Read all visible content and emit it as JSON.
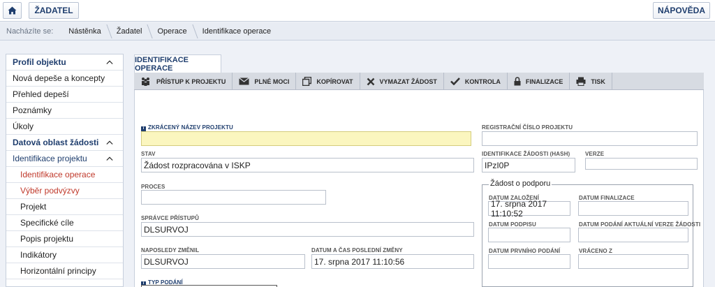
{
  "topbar": {
    "zadatel_label": "ŽADATEL",
    "napoveda_label": "NÁPOVĚDA"
  },
  "breadcrumb": {
    "prefix": "Nacházíte se:",
    "items": [
      "Nástěnka",
      "Žadatel",
      "Operace",
      "Identifikace operace"
    ]
  },
  "sidebar": {
    "items": [
      {
        "label": "Profil objektu"
      },
      {
        "label": "Nová depeše a koncepty"
      },
      {
        "label": "Přehled depeší"
      },
      {
        "label": "Poznámky"
      },
      {
        "label": "Úkoly"
      },
      {
        "label": "Datová oblast žádosti"
      },
      {
        "label": "Identifikace projektu"
      },
      {
        "label": "Identifikace operace"
      },
      {
        "label": "Výběr podvýzvy"
      },
      {
        "label": "Projekt"
      },
      {
        "label": "Specifické cíle"
      },
      {
        "label": "Popis projektu"
      },
      {
        "label": "Indikátory"
      },
      {
        "label": "Horizontální principy"
      }
    ]
  },
  "main": {
    "tab_label": "IDENTIFIKACE OPERACE",
    "toolbar": {
      "pristup": "PŘÍSTUP K PROJEKTU",
      "plne_moci": "PLNÉ MOCI",
      "kopirovat": "KOPÍROVAT",
      "vymazat": "VYMAZAT ŽÁDOST",
      "kontrola": "KONTROLA",
      "finalizace": "FINALIZACE",
      "tisk": "TISK"
    },
    "form": {
      "zkraceny_label": "ZKRÁCENÝ NÁZEV PROJEKTU",
      "zkraceny_value": "",
      "registracni_label": "REGISTRAČNÍ ČÍSLO PROJEKTU",
      "registracni_value": "",
      "stav_label": "STAV",
      "stav_value": "Žádost rozpracována v ISKP",
      "hash_label": "IDENTIFIKACE ŽÁDOSTI (HASH)",
      "hash_value": "IPzI0P",
      "verze_label": "VERZE",
      "verze_value": "",
      "proces_label": "PROCES",
      "proces_value": "",
      "spravce_label": "SPRÁVCE PŘÍSTUPŮ",
      "spravce_value": "DLSURVOJ",
      "zmenil_label": "NAPOSLEDY ZMĚNIL",
      "zmenil_value": "DLSURVOJ",
      "datum_zmeny_label": "DATUM A ČAS POSLEDNÍ ZMĚNY",
      "datum_zmeny_value": "17. srpna 2017 11:10:56",
      "typ_podani_label": "TYP PODÁNÍ"
    },
    "podpora": {
      "legend": "Žádost o podporu",
      "zalozeni_label": "DATUM ZALOŽENÍ",
      "zalozeni_value": "17. srpna 2017 11:10:52",
      "finalizace_label": "DATUM FINALIZACE",
      "finalizace_value": "",
      "podpisu_label": "DATUM PODPISU",
      "podpisu_value": "",
      "podani_label": "DATUM PODÁNÍ AKTUÁLNÍ VERZE ŽÁDOSTI",
      "podani_value": "",
      "prvni_label": "DATUM PRVNÍHO PODÁNÍ",
      "prvni_value": "",
      "vraceno_label": "VRÁCENO Z",
      "vraceno_value": ""
    }
  }
}
